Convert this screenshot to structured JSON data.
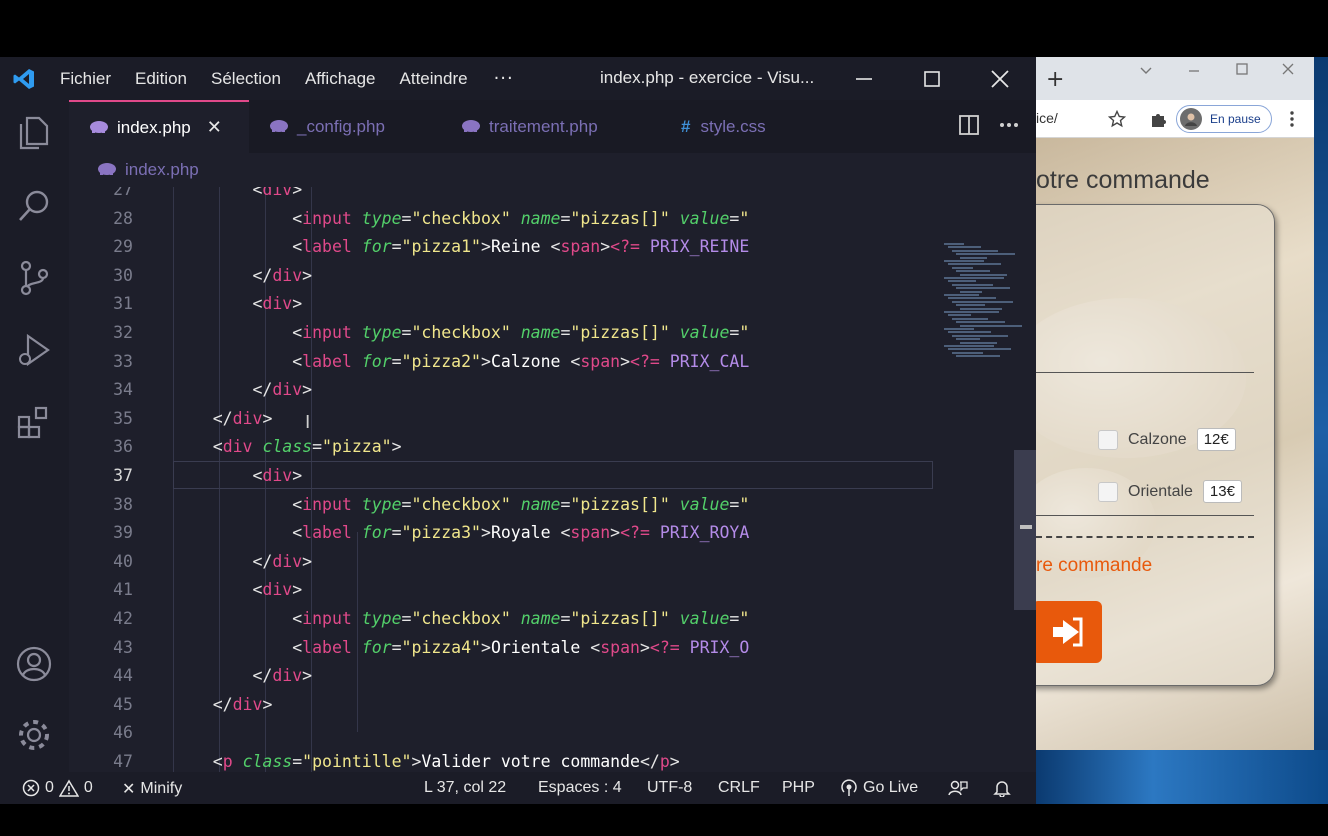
{
  "vscode": {
    "menu": [
      "Fichier",
      "Edition",
      "Sélection",
      "Affichage",
      "Atteindre"
    ],
    "menu_more": "···",
    "window_title": "index.php - exercice - Visu...",
    "tabs": [
      {
        "label": "index.php",
        "active": true
      },
      {
        "label": "_config.php",
        "active": false
      },
      {
        "label": "traitement.php",
        "active": false
      },
      {
        "label": "style.css",
        "active": false
      }
    ],
    "tab_close": "✕",
    "css_icon": "#",
    "breadcrumb": "index.php",
    "code_lines": [
      {
        "n": "27",
        "html": "        <div>"
      },
      {
        "n": "28"
      },
      {
        "n": "29"
      },
      {
        "n": "30"
      },
      {
        "n": "31"
      },
      {
        "n": "32"
      },
      {
        "n": "33"
      },
      {
        "n": "34"
      },
      {
        "n": "35"
      },
      {
        "n": "36"
      },
      {
        "n": "37"
      },
      {
        "n": "38"
      },
      {
        "n": "39"
      },
      {
        "n": "40"
      },
      {
        "n": "41"
      },
      {
        "n": "42"
      },
      {
        "n": "43"
      },
      {
        "n": "44"
      },
      {
        "n": "45"
      },
      {
        "n": "46"
      },
      {
        "n": "47"
      }
    ],
    "status": {
      "errors": "0",
      "warnings": "0",
      "minify": "Minify",
      "position": "L 37, col 22",
      "spaces": "Espaces : 4",
      "encoding": "UTF-8",
      "eol": "CRLF",
      "language": "PHP",
      "golive": "Go Live"
    },
    "colors": {
      "accent_tab": "#e0498a",
      "tag": "#e0498a",
      "attr": "#53d06a",
      "string": "#f0e68c"
    }
  },
  "browser": {
    "url": "ice/",
    "pause_label": "En pause",
    "card_title": "otre commande",
    "pizzas": [
      {
        "name": "Calzone",
        "price": "12€"
      },
      {
        "name": "Orientale",
        "price": "13€"
      }
    ],
    "valider": "re commande",
    "colors": {
      "orange": "#e8590c"
    }
  }
}
